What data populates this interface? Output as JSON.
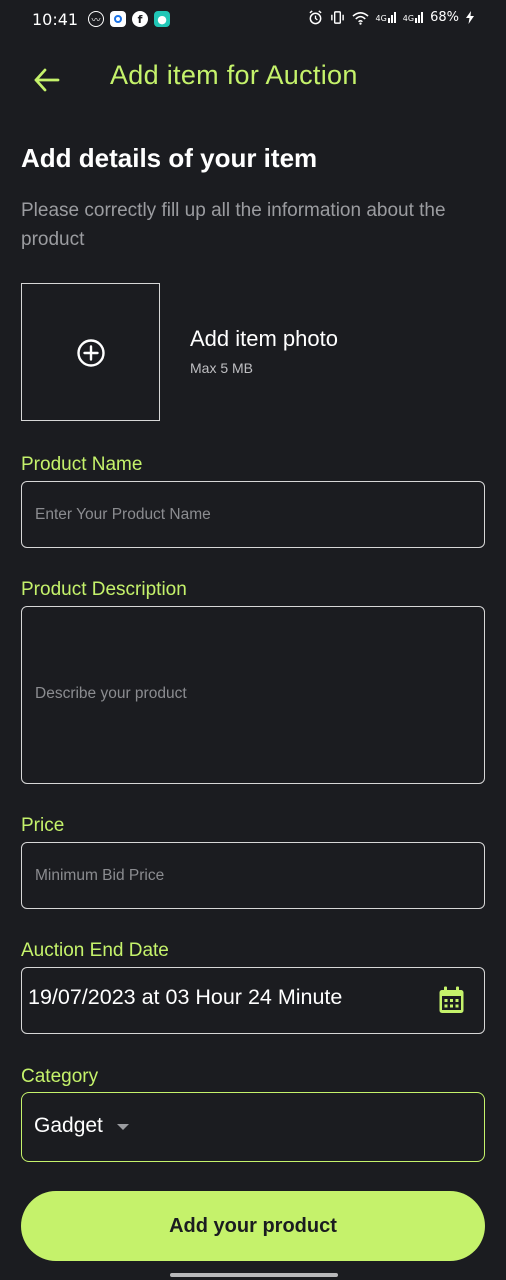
{
  "status_bar": {
    "time": "10:41",
    "battery": "68%",
    "network_1": "4G",
    "network_2": "4G",
    "left_icons": [
      "messenger-icon",
      "blue-app-icon",
      "facebook-icon",
      "chat-app-icon"
    ],
    "right_icons": [
      "alarm-icon",
      "vibrate-icon",
      "wifi-icon",
      "signal-icon",
      "signal-icon",
      "battery-charging-icon"
    ]
  },
  "app_bar": {
    "title": "Add item for Auction",
    "back_icon": "arrow-left-icon"
  },
  "section": {
    "heading": "Add details of your item",
    "subtitle": "Please correctly fill up all the information about the product"
  },
  "photo": {
    "label": "Add item photo",
    "hint": "Max 5 MB",
    "icon": "plus-circle-icon"
  },
  "fields": {
    "product_name": {
      "label": "Product Name",
      "placeholder": "Enter Your Product Name",
      "value": ""
    },
    "product_description": {
      "label": "Product Description",
      "placeholder": "Describe your product",
      "value": ""
    },
    "price": {
      "label": "Price",
      "placeholder": "Minimum Bid Price",
      "value": ""
    },
    "auction_end_date": {
      "label": "Auction End Date",
      "value": "19/07/2023 at 03 Hour 24 Minute",
      "icon": "calendar-icon"
    },
    "category": {
      "label": "Category",
      "value": "Gadget",
      "icon": "caret-down-icon"
    }
  },
  "submit_button": {
    "label": "Add your product"
  },
  "colors": {
    "accent": "#c5f26b",
    "background": "#1b1c20",
    "muted_text": "#9b9ca0",
    "border": "#d7d7d7"
  }
}
